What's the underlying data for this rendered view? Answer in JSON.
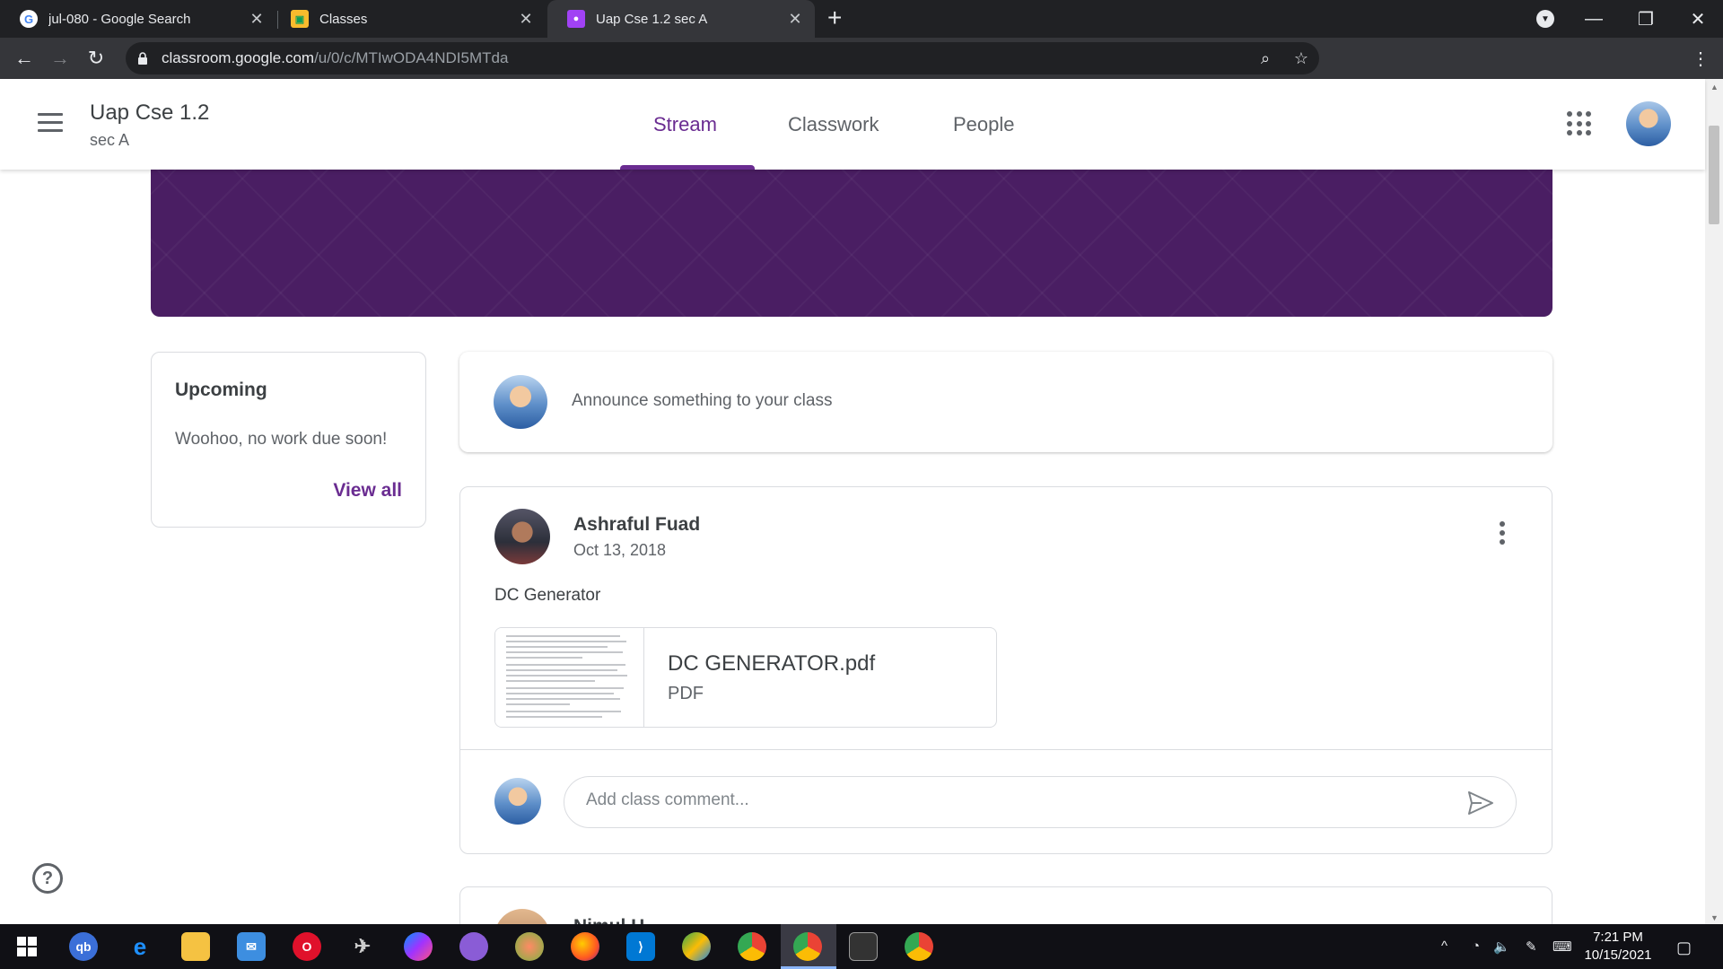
{
  "browser": {
    "tabs": [
      {
        "title": "jul-080 - Google Search",
        "favicon": "google-g-icon"
      },
      {
        "title": "Classes",
        "favicon": "classroom-icon"
      },
      {
        "title": "Uap Cse 1.2 sec A",
        "favicon": "classroom-class-icon",
        "active": true
      }
    ],
    "url_host": "classroom.google.com",
    "url_path": "/u/0/c/MTIwODA4NDI5MTda"
  },
  "header": {
    "class_name": "Uap Cse 1.2",
    "section": "sec A",
    "tabs": [
      "Stream",
      "Classwork",
      "People"
    ],
    "active_tab": "Stream",
    "accent": "#6a2c91"
  },
  "upcoming": {
    "title": "Upcoming",
    "text": "Woohoo, no work due soon!",
    "view_all": "View all"
  },
  "announce": {
    "placeholder": "Announce something to your class"
  },
  "post": {
    "author": "Ashraful Fuad",
    "date": "Oct 13, 2018",
    "body": "DC Generator",
    "attachment": {
      "name": "DC GENERATOR.pdf",
      "type": "PDF"
    },
    "comment_placeholder": "Add class comment..."
  },
  "post2": {
    "author": "Nimul H..."
  },
  "taskbar": {
    "time": "7:21 PM",
    "date": "10/15/2021"
  },
  "colors": {
    "banner": "#4a1e63",
    "chrome_dark": "#202124",
    "taskbar": "#101015"
  }
}
